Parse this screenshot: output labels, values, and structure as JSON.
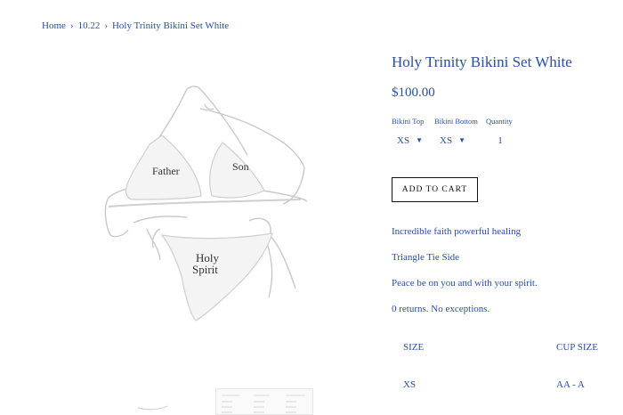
{
  "breadcrumb": {
    "home": "Home",
    "collection": "10.22",
    "current": "Holy Trinity Bikini Set White",
    "separator": "›"
  },
  "product": {
    "title": "Holy Trinity Bikini Set White",
    "price": "$100.00",
    "image_text": {
      "left_cup": "Father",
      "right_cup": "Son",
      "bottom_line1": "Holy",
      "bottom_line2": "Spirit"
    }
  },
  "options": {
    "top_label": "Bikini Top",
    "top_value": "XS",
    "bottom_label": "Bikini Bottom",
    "bottom_value": "XS",
    "quantity_label": "Quantity",
    "quantity_value": "1"
  },
  "add_to_cart_label": "ADD TO CART",
  "description": [
    "Incredible faith powerful healing",
    "Triangle Tie Side",
    "Peace be on you and with your spirit.",
    "0 returns. No exceptions."
  ],
  "size_table": {
    "headers": [
      "SIZE",
      "CUP SIZE"
    ],
    "rows": [
      [
        "XS",
        "AA - A"
      ]
    ]
  },
  "colors": {
    "link": "#2a4f9e",
    "button_border": "#111111"
  }
}
